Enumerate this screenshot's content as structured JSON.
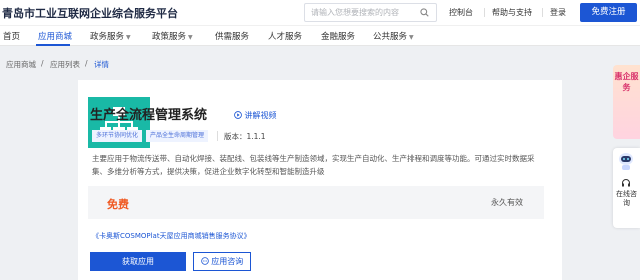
{
  "header": {
    "brand": "青岛市工业互联网企业综合服务平台",
    "search_placeholder": "请输入您想要搜索的内容",
    "links": [
      "控制台",
      "帮助与支持",
      "登录"
    ],
    "register": "免费注册"
  },
  "nav": {
    "items": [
      {
        "label": "首页",
        "dropdown": false
      },
      {
        "label": "应用商城",
        "dropdown": false
      },
      {
        "label": "政务服务",
        "dropdown": true
      },
      {
        "label": "政策服务",
        "dropdown": true
      },
      {
        "label": "供需服务",
        "dropdown": false
      },
      {
        "label": "人才服务",
        "dropdown": false
      },
      {
        "label": "金融服务",
        "dropdown": false
      },
      {
        "label": "公共服务",
        "dropdown": true
      }
    ],
    "active": "应用商城"
  },
  "breadcrumb": [
    "应用商城",
    "应用列表",
    "详情"
  ],
  "app": {
    "title": "生产全流程管理系统",
    "video_label": "讲解视频",
    "tags": [
      "多环节协同优化",
      "产品全生命周期管理"
    ],
    "version_label": "版本：1.1.1",
    "description": "主要应用于物流传送带、自动化焊接、装配线、包装线等生产制造领域，实现生产自动化、生产排程和调度等功能。可通过实时数据采集、多维分析等方式，提供决策，促进企业数字化转型和智能制造升级",
    "price": "免费",
    "validity": "永久有效",
    "agreement": "《卡奥斯COSMOPlat天屋应用商城销售服务协议》",
    "get_button": "获取应用",
    "consult_button": "应用咨询"
  },
  "sidebar_widgets": {
    "promo": "惠企服务",
    "service": "在线咨询"
  },
  "colors": {
    "primary": "#1c56d4",
    "logo_bg": "#19b9a6",
    "price": "#f05a23"
  }
}
